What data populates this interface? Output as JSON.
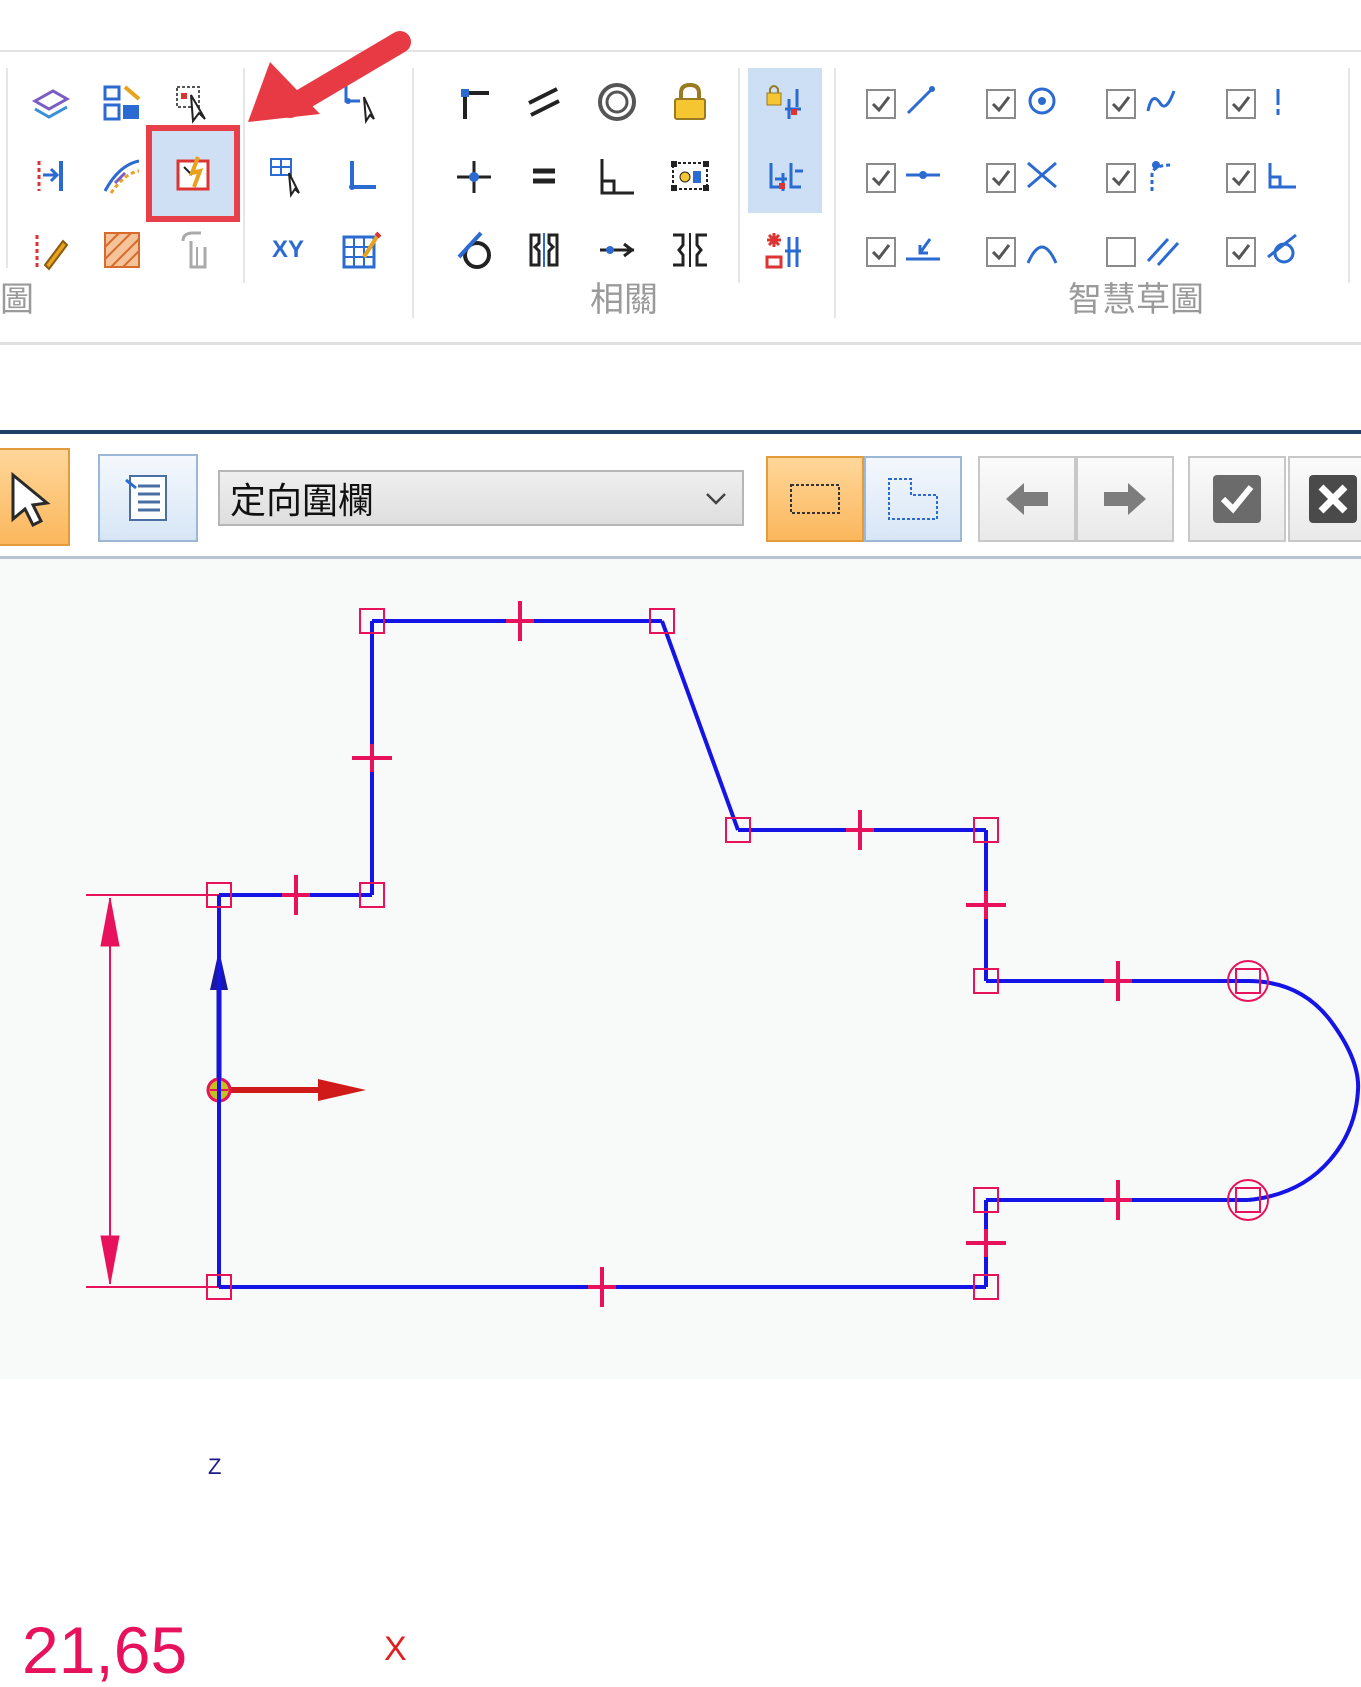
{
  "ribbon": {
    "groups": [
      {
        "label": "圖"
      },
      {
        "label": "相關"
      },
      {
        "label": "智慧草圖"
      }
    ],
    "draw_icons": [
      {
        "name": "project-icon"
      },
      {
        "name": "include-icon"
      },
      {
        "name": "select-tool-icon"
      },
      {
        "name": "mirror-icon"
      },
      {
        "name": "offset-curve-icon"
      },
      {
        "name": "smart-dimension-icon"
      },
      {
        "name": "fill-icon"
      },
      {
        "name": "construction-icon"
      },
      {
        "name": "xy-coordinate-icon"
      }
    ],
    "xy_label": "XY",
    "relate_icons": [
      "horizontal-vertical-icon",
      "parallel-icon",
      "concentric-icon",
      "lock-icon",
      "connect-icon",
      "equal-icon",
      "perpendicular-icon",
      "rigid-set-icon",
      "tangent-icon",
      "symmetric-icon",
      "collinear-icon",
      "symmetric-axis-icon"
    ],
    "intellisketch": [
      {
        "checked": true,
        "icon": "endpoint-line-icon"
      },
      {
        "checked": true,
        "icon": "center-point-icon"
      },
      {
        "checked": true,
        "icon": "curve-point-icon"
      },
      {
        "checked": true,
        "icon": "vertical-icon"
      },
      {
        "checked": true,
        "icon": "midpoint-icon"
      },
      {
        "checked": true,
        "icon": "intersection-icon"
      },
      {
        "checked": true,
        "icon": "tangent-extension-icon"
      },
      {
        "checked": true,
        "icon": "perpendicular-icon"
      },
      {
        "checked": true,
        "icon": "point-on-icon"
      },
      {
        "checked": true,
        "icon": "arc-icon"
      },
      {
        "checked": false,
        "icon": "parallel-icon"
      },
      {
        "checked": true,
        "icon": "tangent-icon"
      }
    ]
  },
  "command_bar": {
    "select_value": "定向圍欄",
    "buttons": [
      "select-arrow-button",
      "options-button",
      "rectangle-fence-button",
      "polygon-fence-button",
      "previous-button",
      "next-button",
      "accept-button",
      "cancel-button"
    ]
  },
  "sketch": {
    "dimension_value": "21,65",
    "axis_x_label": "X",
    "axis_z_label": "Z",
    "colors": {
      "profile": "#1010e0",
      "relation": "#e8125c",
      "dimension": "#e8125c",
      "axis_x": "#e02020"
    }
  }
}
